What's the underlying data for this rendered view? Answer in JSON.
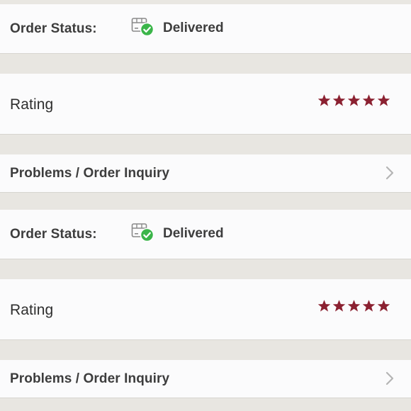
{
  "sections": [
    {
      "status": {
        "label": "Order Status:",
        "value": "Delivered",
        "icon": "package-delivered-icon",
        "check_color": "#3bb54a"
      },
      "rating": {
        "label": "Rating",
        "stars": 5,
        "max_stars": 5,
        "star_color": "#8b2131"
      },
      "inquiry": {
        "label": "Problems / Order Inquiry",
        "icon": "chevron-right-icon"
      }
    },
    {
      "status": {
        "label": "Order Status:",
        "value": "Delivered",
        "icon": "package-delivered-icon",
        "check_color": "#3bb54a"
      },
      "rating": {
        "label": "Rating",
        "stars": 5,
        "max_stars": 5,
        "star_color": "#8b2131"
      },
      "inquiry": {
        "label": "Problems / Order Inquiry",
        "icon": "chevron-right-icon"
      }
    }
  ]
}
